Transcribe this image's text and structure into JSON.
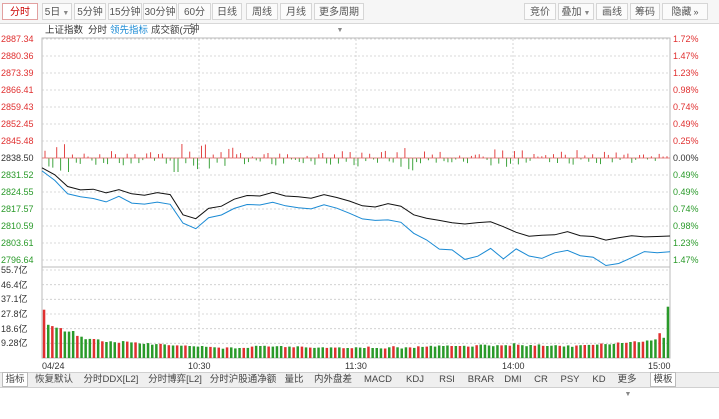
{
  "toolbar": {
    "left": [
      {
        "label": "分时",
        "active": true
      },
      {
        "label": "5日",
        "dropdown": true
      },
      {
        "label": "5分钟"
      },
      {
        "label": "15分钟"
      },
      {
        "label": "30分钟"
      },
      {
        "label": "60分钟"
      },
      {
        "label": "日线"
      },
      {
        "label": "周线"
      },
      {
        "label": "月线"
      },
      {
        "label": "更多周期",
        "dropdown": true
      }
    ],
    "right": [
      {
        "label": "竞价"
      },
      {
        "label": "叠加",
        "dropdown": true
      },
      {
        "label": "画线"
      },
      {
        "label": "筹码"
      },
      {
        "label": "隐藏"
      }
    ],
    "nav_icon": "double-chevron-right-icon"
  },
  "subtitle": {
    "index_name": "上证指数",
    "mode": "分时",
    "leading": "领先指标",
    "volume": "成交额(元)"
  },
  "colors": {
    "up": "#e03030",
    "down": "#2a9a2a",
    "price_line": "#111111",
    "leading_line": "#1a8ad4",
    "grid": "#cccccc"
  },
  "chart_data": [
    {
      "type": "line",
      "x_labels": [
        "04/24",
        "10:30",
        "11:30",
        "14:00",
        "15:00"
      ],
      "y_left_ticks": [
        "2887.34",
        "2880.36",
        "2873.39",
        "2866.41",
        "2859.43",
        "2852.45",
        "2845.48",
        "2838.50",
        "2831.52",
        "2824.55",
        "2817.57",
        "2810.59",
        "2803.61",
        "2796.64"
      ],
      "y_right_ticks": [
        "1.72%",
        "1.47%",
        "1.23%",
        "0.98%",
        "0.74%",
        "0.49%",
        "0.25%",
        "0.00%",
        "0.49%",
        "0.49%",
        "0.74%",
        "0.98%",
        "1.23%",
        "1.47%"
      ],
      "ylim": [
        2796.64,
        2887.34
      ],
      "series": [
        {
          "name": "上证指数",
          "values": [
            2834.5,
            2831.6,
            2826.8,
            2825.4,
            2825.7,
            2824.2,
            2825.5,
            2823.8,
            2823.2,
            2824.3,
            2823.5,
            2815.2,
            2813.6,
            2817.8,
            2818.7,
            2821.6,
            2823.1,
            2822.9,
            2824.4,
            2822.9,
            2822.6,
            2822.0,
            2823.5,
            2822.3,
            2820.8,
            2818.9,
            2818.4,
            2819.8,
            2818.7,
            2815.2,
            2813.8,
            2812.9,
            2811.9,
            2811.4,
            2812.0,
            2812.3,
            2810.3,
            2808.0,
            2806.4,
            2806.8,
            2807.0,
            2808.3,
            2806.6,
            2806.3,
            2804.8,
            2805.8,
            2806.6,
            2806.1,
            2806.3,
            2806.5
          ]
        },
        {
          "name": "领先指标",
          "values": [
            2833.2,
            2829.3,
            2823.8,
            2822.6,
            2821.9,
            2820.5,
            2822.8,
            2820.0,
            2819.6,
            2820.4,
            2819.5,
            2811.8,
            2809.5,
            2814.0,
            2815.1,
            2817.8,
            2819.4,
            2819.2,
            2820.3,
            2818.9,
            2818.1,
            2817.6,
            2819.3,
            2817.9,
            2815.8,
            2813.5,
            2812.9,
            2813.1,
            2812.1,
            2807.6,
            2804.9,
            2801.1,
            2800.8,
            2796.9,
            2798.2,
            2801.4,
            2797.1,
            2801.2,
            2798.3,
            2797.3,
            2799.6,
            2800.6,
            2798.4,
            2797.8,
            2794.4,
            2795.2,
            2797.6,
            2800.1,
            2799.6,
            2800.0
          ]
        }
      ]
    },
    {
      "type": "bar",
      "name": "成交额(元)",
      "y_ticks": [
        "55.7亿",
        "46.4亿",
        "37.1亿",
        "27.8亿",
        "18.6亿",
        "9.28亿"
      ],
      "ylim": [
        0,
        55.7
      ],
      "values": [
        30.6,
        21.0,
        20.2,
        19.2,
        18.9,
        16.8,
        16.7,
        17.1,
        14.0,
        13.5,
        11.9,
        12.1,
        12.0,
        11.8,
        10.6,
        10.1,
        10.6,
        10.0,
        9.6,
        10.7,
        10.4,
        9.9,
        9.9,
        9.2,
        8.9,
        9.4,
        8.4,
        8.8,
        9.0,
        8.6,
        8.1,
        7.9,
        8.0,
        7.8,
        7.9,
        7.6,
        7.4,
        7.2,
        7.6,
        7.1,
        7.0,
        6.8,
        6.6,
        5.9,
        6.7,
        6.7,
        6.1,
        6.3,
        6.4,
        6.4,
        7.2,
        7.7,
        7.6,
        7.7,
        7.3,
        7.2,
        7.5,
        7.6,
        6.9,
        7.2,
        6.8,
        7.4,
        7.2,
        6.7,
        6.6,
        6.4,
        6.6,
        6.8,
        6.4,
        6.7,
        6.6,
        6.7,
        6.2,
        6.3,
        6.2,
        6.8,
        6.6,
        6.3,
        7.2,
        6.3,
        6.3,
        6.1,
        6.0,
        6.8,
        7.5,
        6.8,
        6.0,
        6.8,
        6.7,
        6.4,
        7.4,
        7.0,
        7.2,
        7.7,
        7.2,
        7.9,
        7.6,
        7.9,
        7.6,
        7.6,
        7.6,
        7.7,
        7.2,
        7.2,
        8.1,
        8.5,
        8.4,
        7.9,
        7.5,
        8.1,
        8.0,
        8.1,
        7.8,
        9.3,
        8.4,
        8.1,
        7.5,
        8.2,
        7.8,
        8.6,
        7.7,
        7.6,
        7.8,
        8.1,
        7.7,
        7.3,
        8.0,
        7.1,
        7.9,
        8.1,
        8.2,
        8.3,
        8.3,
        8.5,
        9.2,
        8.8,
        8.6,
        8.9,
        9.8,
        9.5,
        9.6,
        10.1,
        10.6,
        10.0,
        10.3,
        11.1,
        11.1,
        11.8,
        15.7,
        12.8,
        32.5
      ]
    }
  ],
  "bottom_tabs": [
    {
      "label": "指标",
      "active": true
    },
    {
      "label": "恢复默认"
    },
    {
      "label": "分时DDX[L2]"
    },
    {
      "label": "分时博弈[L2]"
    },
    {
      "label": "分时沪股通净额"
    },
    {
      "label": "量比"
    },
    {
      "label": "内外盘差"
    },
    {
      "label": "MACD"
    },
    {
      "label": "KDJ"
    },
    {
      "label": "RSI"
    },
    {
      "label": "BRAR"
    },
    {
      "label": "DMI"
    },
    {
      "label": "CR"
    },
    {
      "label": "PSY"
    },
    {
      "label": "KD"
    },
    {
      "label": "更多",
      "dropdown": true
    },
    {
      "label": "模板",
      "active": true
    }
  ]
}
